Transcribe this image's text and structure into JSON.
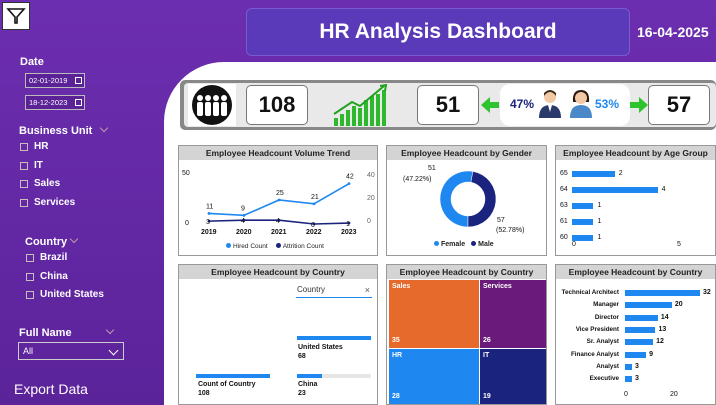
{
  "header": {
    "title": "HR Analysis Dashboard",
    "date": "16-04-2025"
  },
  "sidebar": {
    "date_label": "Date",
    "date_from": "02-01-2019",
    "date_to": "18-12-2023",
    "business_unit_label": "Business Unit",
    "business_units": [
      "HR",
      "IT",
      "Sales",
      "Services"
    ],
    "country_label": "Country",
    "countries": [
      "Brazil",
      "China",
      "United States"
    ],
    "full_name_label": "Full Name",
    "full_name_value": "All",
    "export_label": "Export Data"
  },
  "kpis": {
    "total_headcount": "108",
    "new_hires": "51",
    "attrition": "57",
    "male_pct": "47%",
    "female_pct": "53%"
  },
  "colors": {
    "accent": "#1e88f0",
    "dark_blue": "#1a237e",
    "purple": "#6c2eb0"
  },
  "chart_data": [
    {
      "type": "line",
      "title": "Employee Headcount Volume Trend",
      "x": [
        "2019",
        "2020",
        "2021",
        "2022",
        "2023"
      ],
      "series": [
        {
          "name": "Hired Count",
          "values": [
            11,
            9,
            25,
            21,
            42
          ]
        },
        {
          "name": "Attrition Count",
          "values": [
            3,
            4,
            4,
            0,
            1
          ]
        }
      ],
      "ylim": [
        0,
        50
      ],
      "left_ticks": [
        "50",
        "0"
      ],
      "right_ticks": [
        "40",
        "20",
        "0"
      ]
    },
    {
      "type": "pie",
      "title": "Employee Headcount by Gender",
      "categories": [
        "Female",
        "Male"
      ],
      "values": [
        57,
        51
      ],
      "labels": [
        {
          "count": "57",
          "pct": "(52.78%)"
        },
        {
          "count": "51",
          "pct": "(47.22%)"
        }
      ]
    },
    {
      "type": "bar",
      "title": "Employee Headcount by Age Group",
      "categories": [
        "65",
        "64",
        "63",
        "61",
        "60"
      ],
      "values": [
        2,
        4,
        1,
        1,
        1
      ],
      "xticks": [
        "0",
        "5"
      ],
      "xlim": [
        0,
        5
      ]
    },
    {
      "type": "bar",
      "title": "Employee Headcount by Country",
      "categories": [
        "United States",
        "China"
      ],
      "values": [
        68,
        23
      ],
      "total_label": "Count of Country",
      "total_value": "108",
      "slicer_label": "Country"
    },
    {
      "type": "heatmap",
      "title": "Employee Headcount by Country",
      "categories": [
        "Sales",
        "Services",
        "HR",
        "IT"
      ],
      "values": [
        35,
        26,
        28,
        19
      ]
    },
    {
      "type": "bar",
      "title": "Employee Headcount by Country",
      "categories": [
        "Technical Architect",
        "Manager",
        "Director",
        "Vice President",
        "Sr. Analyst",
        "Finance Analyst",
        "Analyst",
        "Executive"
      ],
      "values": [
        32,
        20,
        14,
        13,
        12,
        9,
        3,
        3
      ],
      "xticks": [
        "0",
        "20"
      ],
      "xlim": [
        0,
        32
      ]
    }
  ]
}
